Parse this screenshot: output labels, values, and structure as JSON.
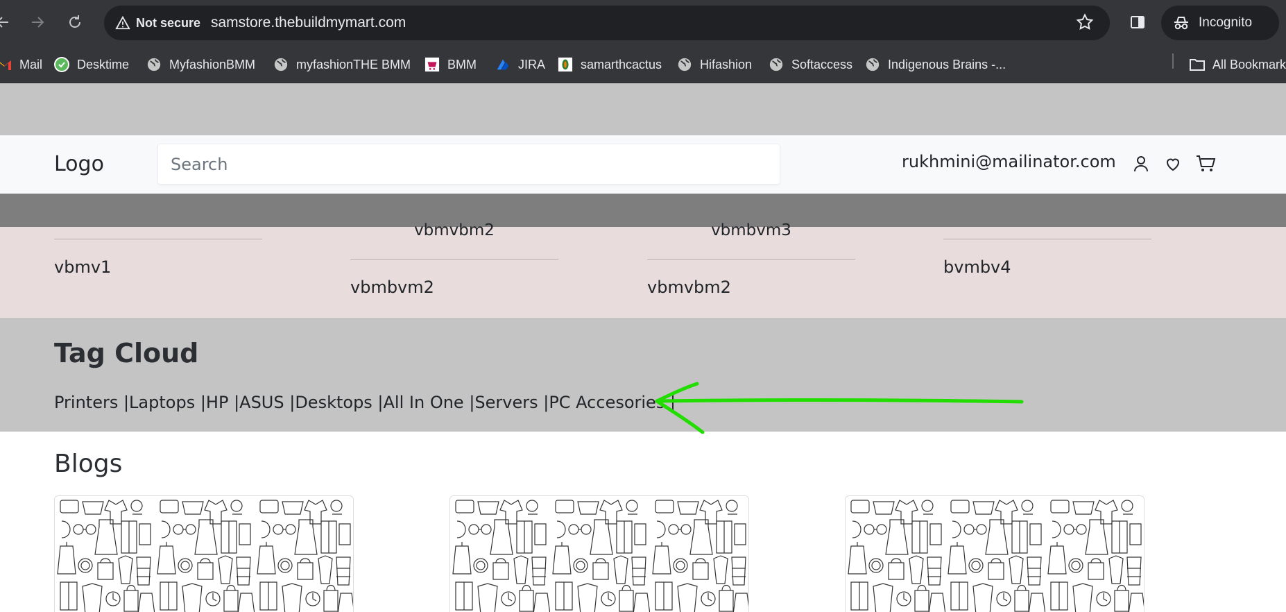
{
  "browser": {
    "security_label": "Not secure",
    "url": "samstore.thebuildmymart.com",
    "incognito_label": "Incognito",
    "bookmarks": [
      {
        "label": "Mail",
        "icon": "gmail-icon"
      },
      {
        "label": "Desktime",
        "icon": "desktime-icon"
      },
      {
        "label": "MyfashionBMM",
        "icon": "globe-icon"
      },
      {
        "label": "myfashionTHE BMM",
        "icon": "globe-icon"
      },
      {
        "label": "BMM",
        "icon": "bmm-icon"
      },
      {
        "label": "JIRA",
        "icon": "jira-icon"
      },
      {
        "label": "samarthcactus",
        "icon": "cactus-icon"
      },
      {
        "label": "Hifashion",
        "icon": "globe-icon"
      },
      {
        "label": "Softaccess",
        "icon": "globe-icon"
      },
      {
        "label": "Indigenous Brains -...",
        "icon": "globe-icon"
      }
    ],
    "all_bookmarks_label": "All Bookmarks"
  },
  "header": {
    "logo": "Logo",
    "search_placeholder": "Search",
    "user_email": "rukhmini@mailinator.com"
  },
  "footer_columns": [
    {
      "title": "",
      "item": "vbmv1"
    },
    {
      "title": "vbmvbm2",
      "item": "vbmbvm2"
    },
    {
      "title": "vbmbvm3",
      "item": "vbmvbm2"
    },
    {
      "title": "",
      "item": "bvmbv4"
    }
  ],
  "tag_cloud": {
    "heading": "Tag Cloud",
    "tags_text": "Printers |Laptops |HP |ASUS |Desktops |All In One |Servers |PC Accesories |"
  },
  "blogs": {
    "heading": "Blogs",
    "card_count": 3
  },
  "colors": {
    "chrome": "#35363a",
    "grey_band": "#c4c4c4",
    "pink_band": "#e8dcdc",
    "annotation_arrow": "#22dd00"
  }
}
